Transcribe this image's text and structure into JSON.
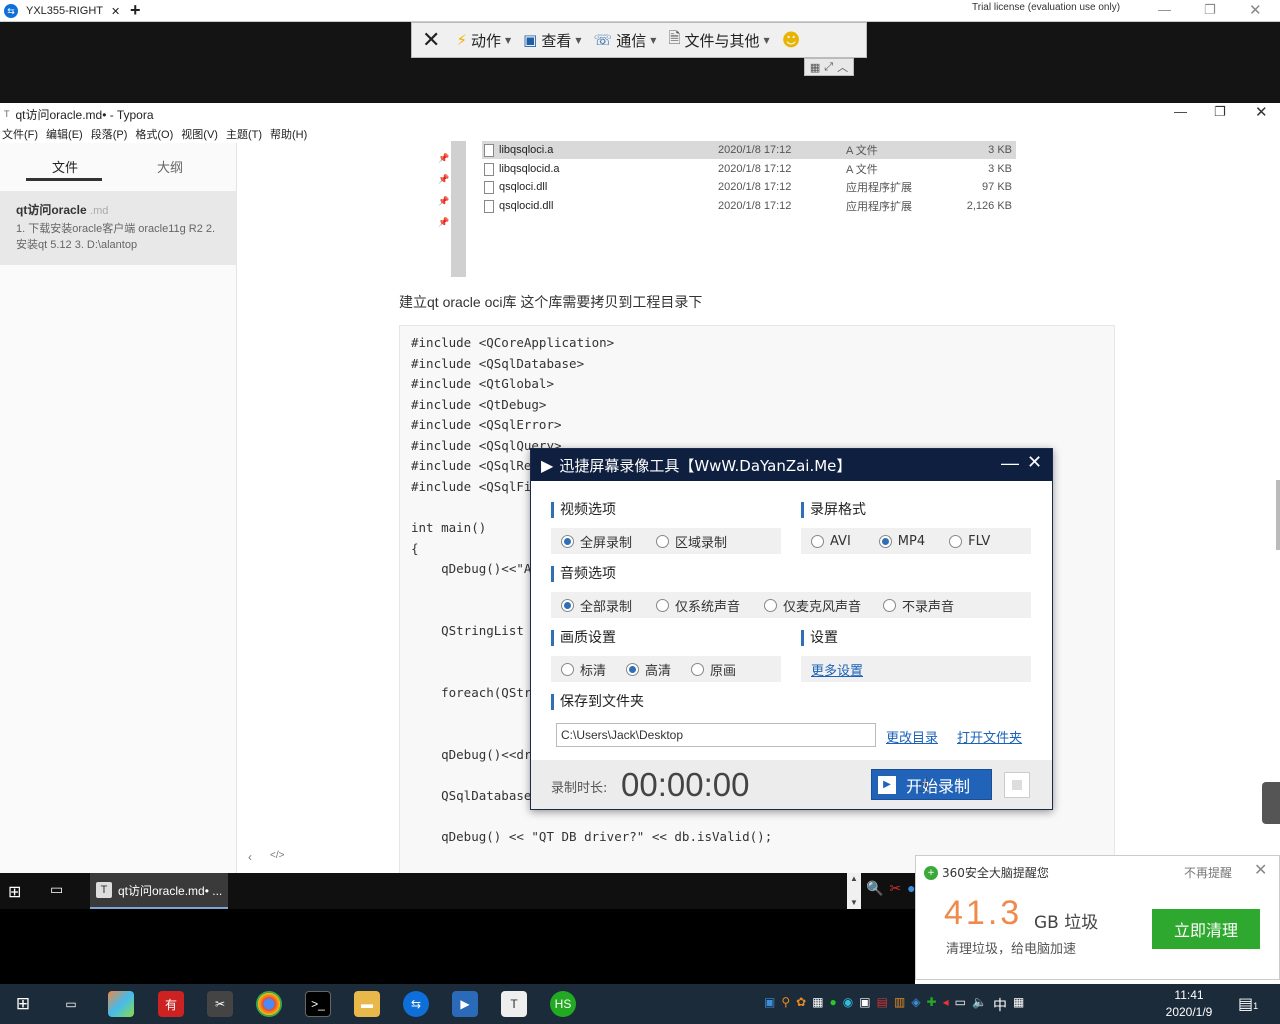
{
  "teamviewer": {
    "tab_title": "YXL355-RIGHT",
    "tab_close": "✕",
    "new_tab": "+",
    "trial": "Trial license (evaluation use only)",
    "toolbar": [
      {
        "label": "动作",
        "icon": "bolt-icon"
      },
      {
        "label": "查看",
        "icon": "monitor-icon"
      },
      {
        "label": "通信",
        "icon": "phone-icon"
      },
      {
        "label": "文件与其他",
        "icon": "file-transfer-icon"
      }
    ]
  },
  "typora": {
    "title": "qt访问oracle.md• - Typora",
    "menu": [
      "文件(F)",
      "编辑(E)",
      "段落(P)",
      "格式(O)",
      "视图(V)",
      "主题(T)",
      "帮助(H)"
    ],
    "sidebar": {
      "tab_files": "文件",
      "tab_outline": "大纲",
      "file_name": "qt访问oracle",
      "file_ext": ".md",
      "file_desc": "1. 下载安装oracle客户端 oracle11g R2 2. 安装qt 5.12 3. D:\\alantop"
    },
    "files": [
      {
        "name": "libqsqloci.a",
        "date": "2020/1/8 17:12",
        "type": "A 文件",
        "size": "3 KB"
      },
      {
        "name": "libqsqlocid.a",
        "date": "2020/1/8 17:12",
        "type": "A 文件",
        "size": "3 KB"
      },
      {
        "name": "qsqloci.dll",
        "date": "2020/1/8 17:12",
        "type": "应用程序扩展",
        "size": "97 KB"
      },
      {
        "name": "qsqlocid.dll",
        "date": "2020/1/8 17:12",
        "type": "应用程序扩展",
        "size": "2,126 KB"
      }
    ],
    "paragraph": "建立qt oracle oci库 这个库需要拷贝到工程目录下",
    "code": [
      "#include <QCoreApplication>",
      "#include <QSqlDatabase>",
      "#include <QtGlobal>",
      "#include <QtDebug>",
      "#include <QSqlError>",
      "#include <QSqlQuery>",
      "#include <QSqlRe",
      "#include <QSqlFi",
      "",
      "int main()",
      "{",
      "    qDebug()<<\"A",
      "",
      "",
      "    QStringList",
      "",
      "",
      "    foreach(QStr",
      "",
      "",
      "    qDebug()<<dr",
      "",
      "    QSqlDatabase",
      "",
      "    qDebug() << \"QT DB driver?\" << db.isValid();"
    ]
  },
  "recorder": {
    "title": "迅捷屏幕录像工具【WwW.DaYanZai.Me】",
    "video_section": "视频选项",
    "video_options": [
      "全屏录制",
      "区域录制"
    ],
    "format_section": "录屏格式",
    "format_options": [
      "AVI",
      "MP4",
      "FLV"
    ],
    "audio_section": "音频选项",
    "audio_options": [
      "全部录制",
      "仅系统声音",
      "仅麦克风声音",
      "不录声音"
    ],
    "quality_section": "画质设置",
    "quality_options": [
      "标清",
      "高清",
      "原画"
    ],
    "settings_section": "设置",
    "more_settings": "更多设置",
    "save_section": "保存到文件夹",
    "save_path": "C:\\Users\\Jack\\Desktop",
    "change_dir": "更改目录",
    "open_folder": "打开文件夹",
    "duration_label": "录制时长:",
    "duration_value": "00:00:00",
    "start_button": "开始录制"
  },
  "remote_taskbar": {
    "app_label": "qt访问oracle.md• ..."
  },
  "popup360": {
    "title": "360安全大脑提醒您",
    "dismiss": "不再提醒",
    "amount": "41.3",
    "unit": "GB 垃圾",
    "subtitle": "清理垃圾，给电脑加速",
    "button": "立即清理"
  },
  "local_taskbar": {
    "time": "11:41",
    "date": "2020/1/9",
    "ime": "中",
    "notif_count": "1"
  },
  "colors": {
    "recorder_header": "#0f1f3f",
    "accent_blue": "#2063b8",
    "green_button": "#2fa82f",
    "orange_amount": "#f08a4b"
  }
}
